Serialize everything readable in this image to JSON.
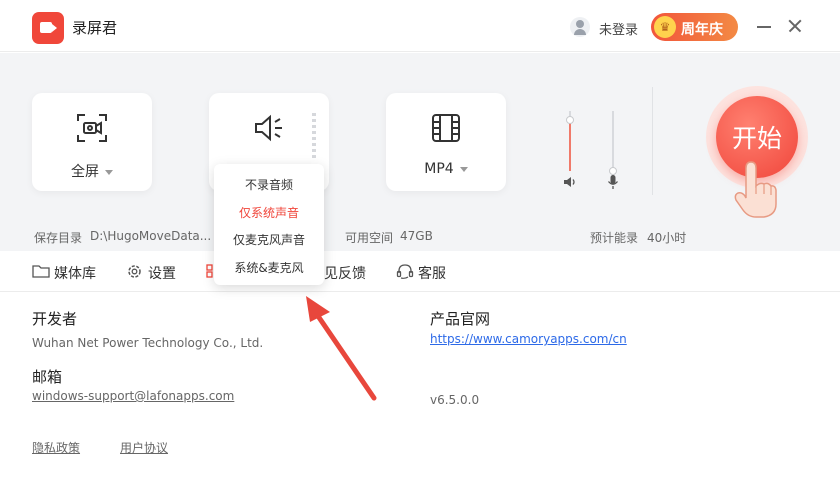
{
  "app": {
    "title": "录屏君"
  },
  "user": {
    "login_label": "未登录"
  },
  "promo": {
    "label": "周年庆"
  },
  "recorder": {
    "mode": {
      "label": "全屏"
    },
    "audio": {
      "menu": [
        "不录音频",
        "仅系统声音",
        "仅麦克风声音",
        "系统&麦克风"
      ],
      "selected": "仅系统声音"
    },
    "format": {
      "label": "MP4"
    },
    "system_volume": 0.85,
    "mic_volume": 0.0,
    "start_label": "开始"
  },
  "info": {
    "save_dir_label": "保存目录",
    "save_dir_value": "D:\\HugoMoveData...",
    "free_space_label": "可用空间",
    "free_space_value": "47GB",
    "estimate_label": "预计能录",
    "estimate_value": "40小时"
  },
  "nav": {
    "media_library": "媒体库",
    "settings": "设置",
    "feedback": "见反馈",
    "support": "客服"
  },
  "about": {
    "developer_label": "开发者",
    "developer_value": "Wuhan Net Power Technology Co., Ltd.",
    "website_label": "产品官网",
    "website_url": "https://www.camoryapps.com/cn",
    "email_label": "邮箱",
    "email_value": "windows-support@lafonapps.com",
    "version": "v6.5.0.0",
    "privacy": "隐私政策",
    "agreement": "用户协议"
  },
  "colors": {
    "accent": "#f0453a",
    "link": "#2d6ae8",
    "panel_bg": "#f3f4f6"
  }
}
